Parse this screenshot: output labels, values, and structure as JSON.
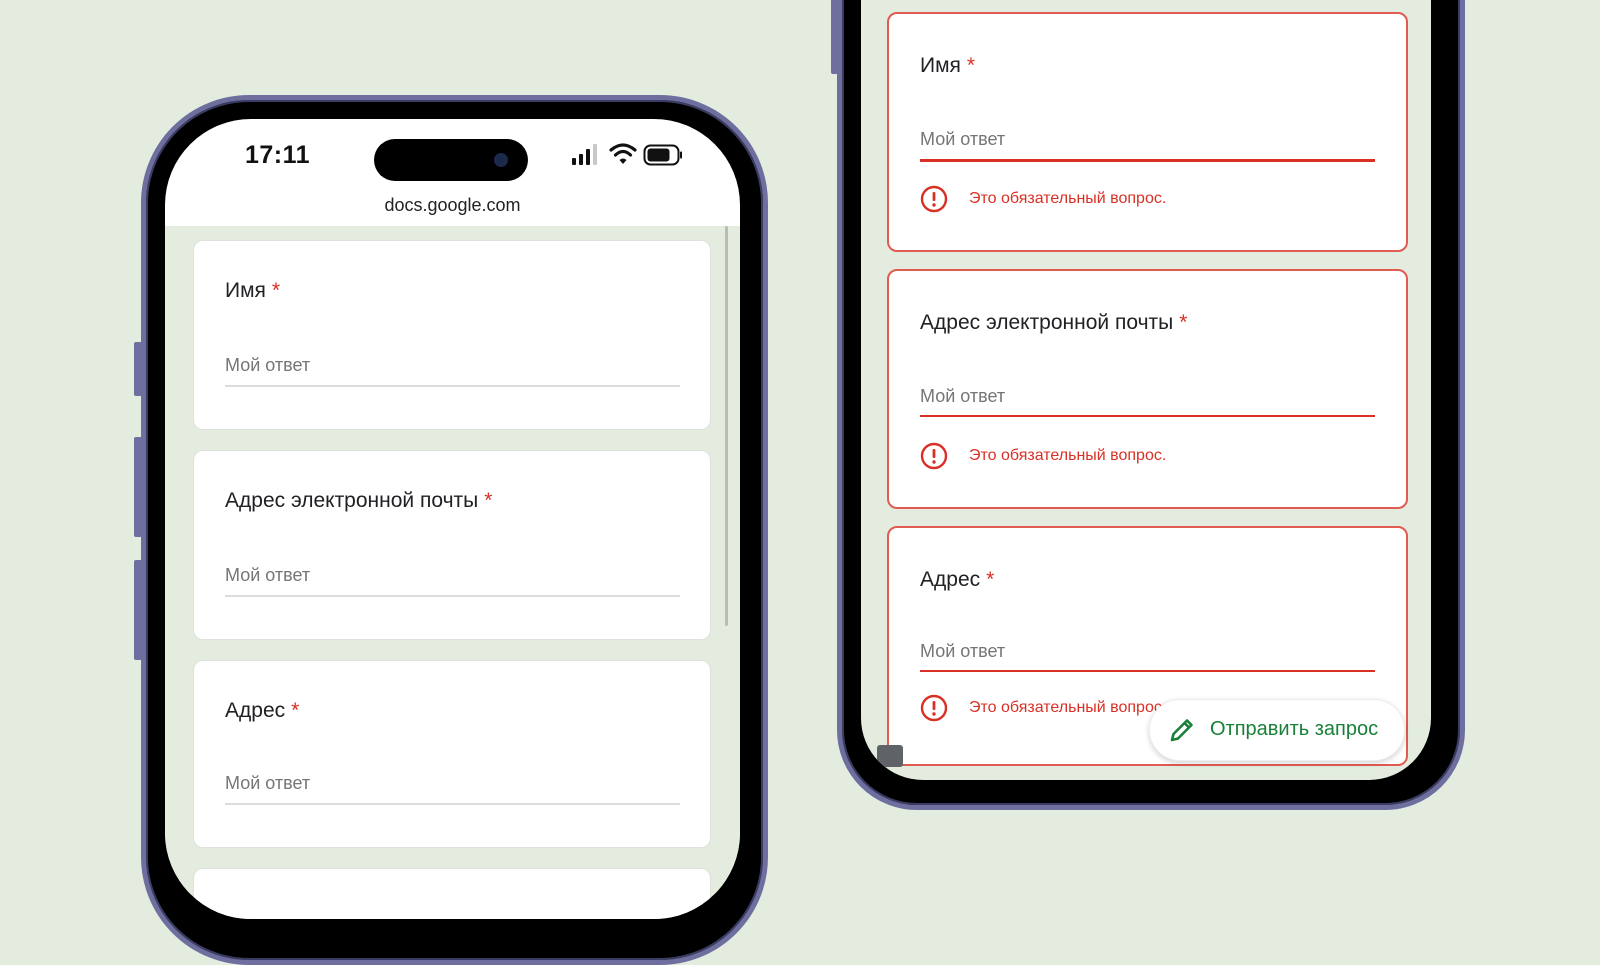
{
  "left_phone": {
    "status_bar": {
      "time": "17:11"
    },
    "browser": {
      "url": "docs.google.com"
    },
    "form": {
      "questions": [
        {
          "label": "Имя",
          "required_mark": "*",
          "placeholder": "Мой ответ"
        },
        {
          "label": "Адрес электронной почты",
          "required_mark": "*",
          "placeholder": "Мой ответ"
        },
        {
          "label": "Адрес",
          "required_mark": "*",
          "placeholder": "Мой ответ"
        }
      ]
    }
  },
  "right_phone": {
    "form": {
      "questions": [
        {
          "label": "Имя",
          "required_mark": "*",
          "placeholder": "Мой ответ",
          "error": "Это обязательный вопрос."
        },
        {
          "label": "Адрес электронной почты",
          "required_mark": "*",
          "placeholder": "Мой ответ",
          "error": "Это обязательный вопрос."
        },
        {
          "label": "Адрес",
          "required_mark": "*",
          "placeholder": "Мой ответ",
          "error": "Это обязательный вопрос."
        }
      ]
    },
    "submit_button": {
      "label": "Отправить запрос",
      "icon": "pencil-icon"
    }
  },
  "colors": {
    "background": "#e3ecdf",
    "phone_frame": "#6e6f9e",
    "error": "#d93025",
    "submit_text": "#188038"
  },
  "icons": {
    "signal": "cellular-signal-icon",
    "wifi": "wifi-icon",
    "battery": "battery-icon",
    "error": "error-circle-icon"
  }
}
